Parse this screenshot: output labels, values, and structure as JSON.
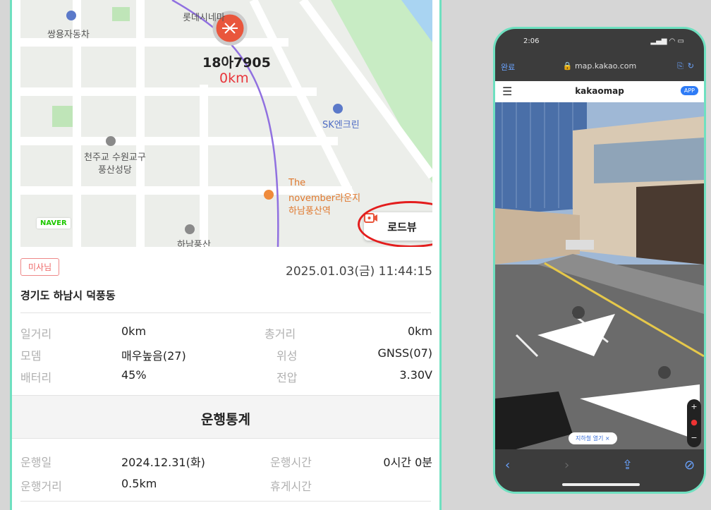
{
  "map": {
    "vehicle_plate": "18아7905",
    "vehicle_distance": "0km",
    "labels": {
      "poi_top_left": "쌍용자동차",
      "poi_top": "롯데시네마",
      "poi_sk": "SK엔크린",
      "poi_church_1": "천주교 수원교구",
      "poi_church_2": "풍산성당",
      "poi_cafe_1": "The",
      "poi_cafe_2": "november라운지",
      "poi_cafe_3": "하남풍산역",
      "poi_bottom": "하남풍산"
    },
    "naver_logo": "NAVER",
    "roadview_label": "로드뷰"
  },
  "info": {
    "badge": "미사님",
    "datetime": "2025.01.03(금) 11:44:15",
    "address": "경기도 하남시 덕풍동",
    "rows": [
      {
        "label": "일거리",
        "value": "0km",
        "label2": "총거리",
        "value2": "0km"
      },
      {
        "label": "모뎀",
        "value": "매우높음(27)",
        "label2": "위성",
        "value2": "GNSS(07)"
      },
      {
        "label": "배터리",
        "value": "45%",
        "label2": "전압",
        "value2": "3.30V"
      }
    ]
  },
  "stats": {
    "title": "운행통계",
    "rows": [
      {
        "label": "운행일",
        "value": "2024.12.31(화)",
        "label2": "운행시간",
        "value2": "0시간 0분"
      },
      {
        "label": "운행거리",
        "value": "0.5km",
        "label2": "휴게시간",
        "value2": ""
      }
    ]
  },
  "phone": {
    "time": "2:06",
    "signal": "▂▄▆ ◠ ▭",
    "url_left": "완료",
    "url": "🔒 map.kakao.com",
    "brand": "kakaomap",
    "app_badge": "APP",
    "pill_text": "지하철 열기  ×",
    "zoom_plus": "+",
    "zoom_minus": "−"
  }
}
